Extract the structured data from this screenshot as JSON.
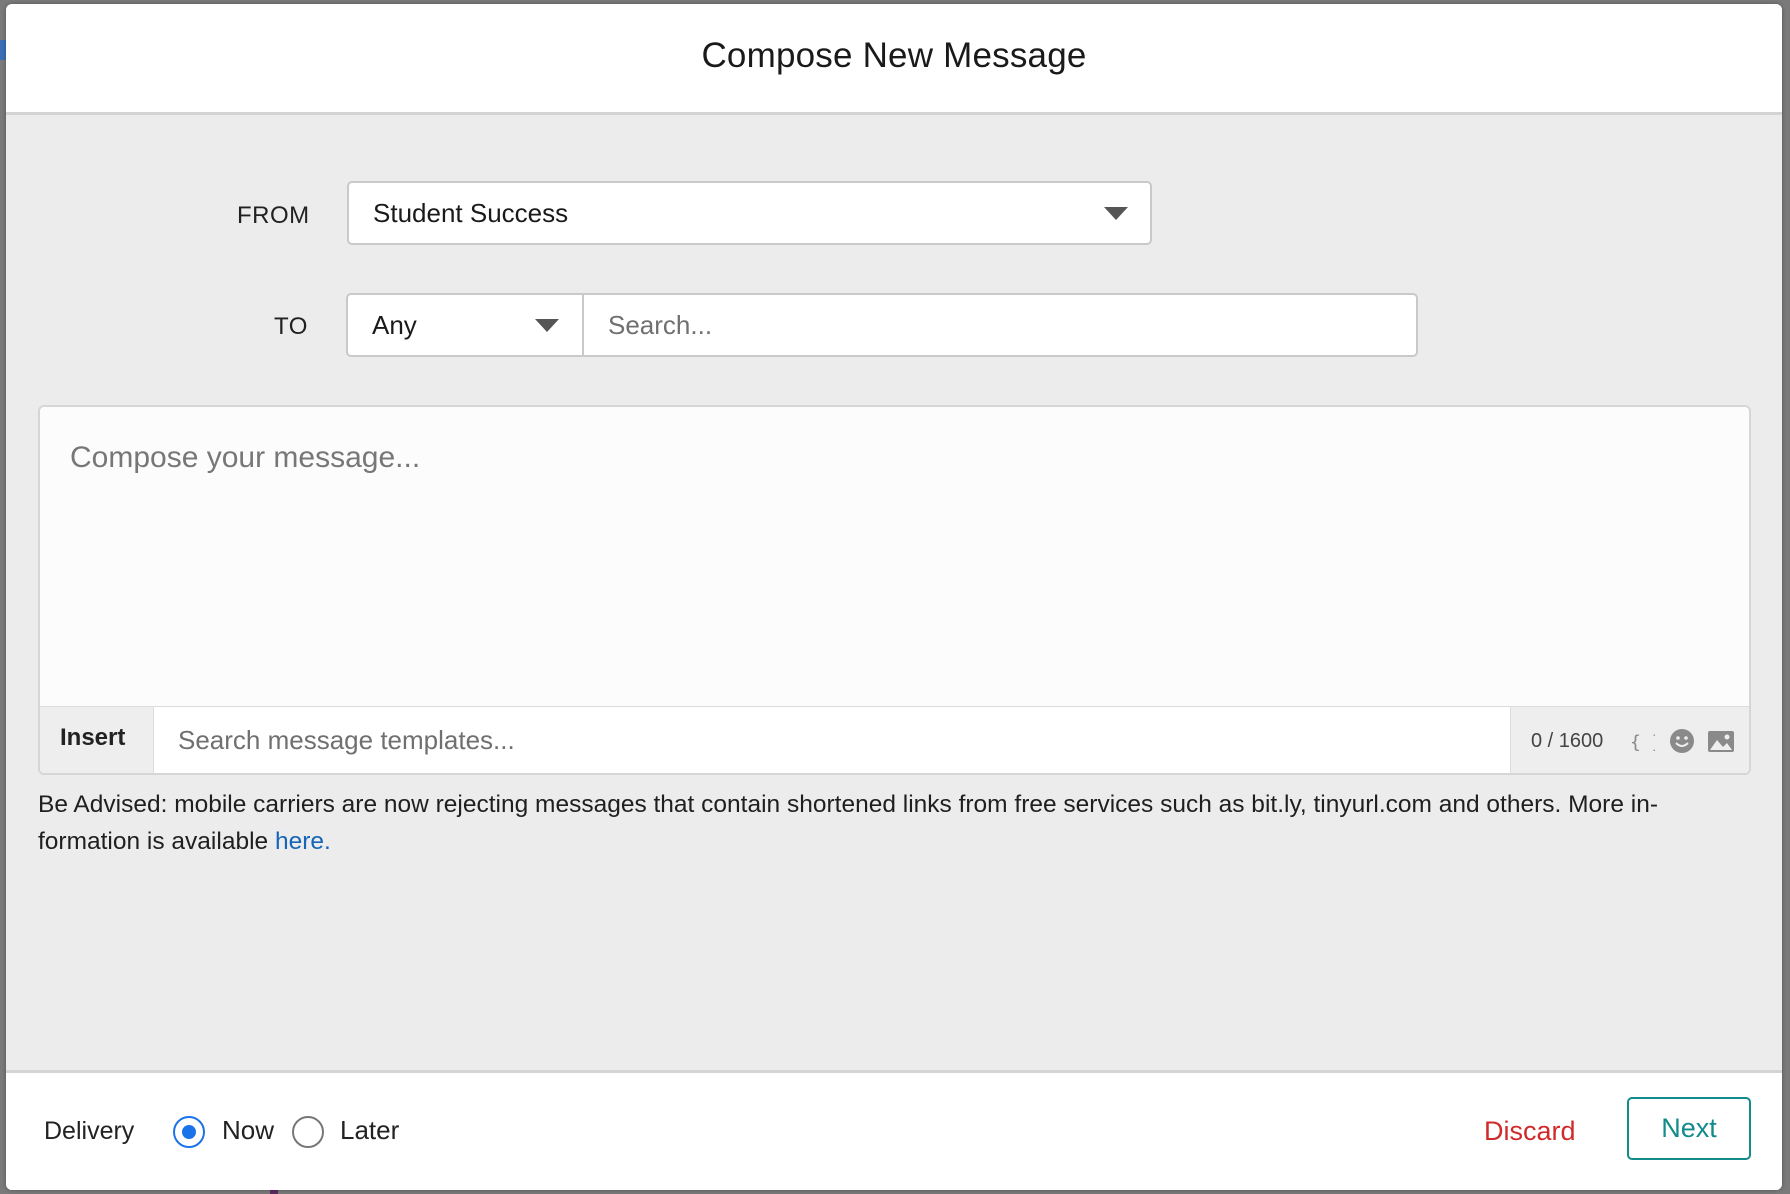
{
  "modal": {
    "title": "Compose New Message"
  },
  "from": {
    "label": "FROM",
    "selected": "Student Success"
  },
  "to": {
    "label": "TO",
    "filter_selected": "Any",
    "search_placeholder": "Search..."
  },
  "compose": {
    "placeholder": "Compose your message...",
    "insert_label": "Insert",
    "template_placeholder": "Search message templates...",
    "char_count": "0 / 1600",
    "icons": [
      "curly-braces-icon",
      "emoji-icon",
      "image-icon"
    ]
  },
  "advisory": {
    "text": "Be Advised: mobile carriers are now rejecting messages that contain shortened links from free services such as bit.ly, tinyurl.com and others. More in-formation is available ",
    "link_text": "here."
  },
  "footer": {
    "delivery_label": "Delivery",
    "options": [
      {
        "label": "Now",
        "checked": true
      },
      {
        "label": "Later",
        "checked": false
      }
    ],
    "discard_label": "Discard",
    "next_label": "Next"
  },
  "colors": {
    "accent": "#1a73e8",
    "next": "#138b8b",
    "discard": "#d02a2a",
    "link": "#1565b8"
  }
}
